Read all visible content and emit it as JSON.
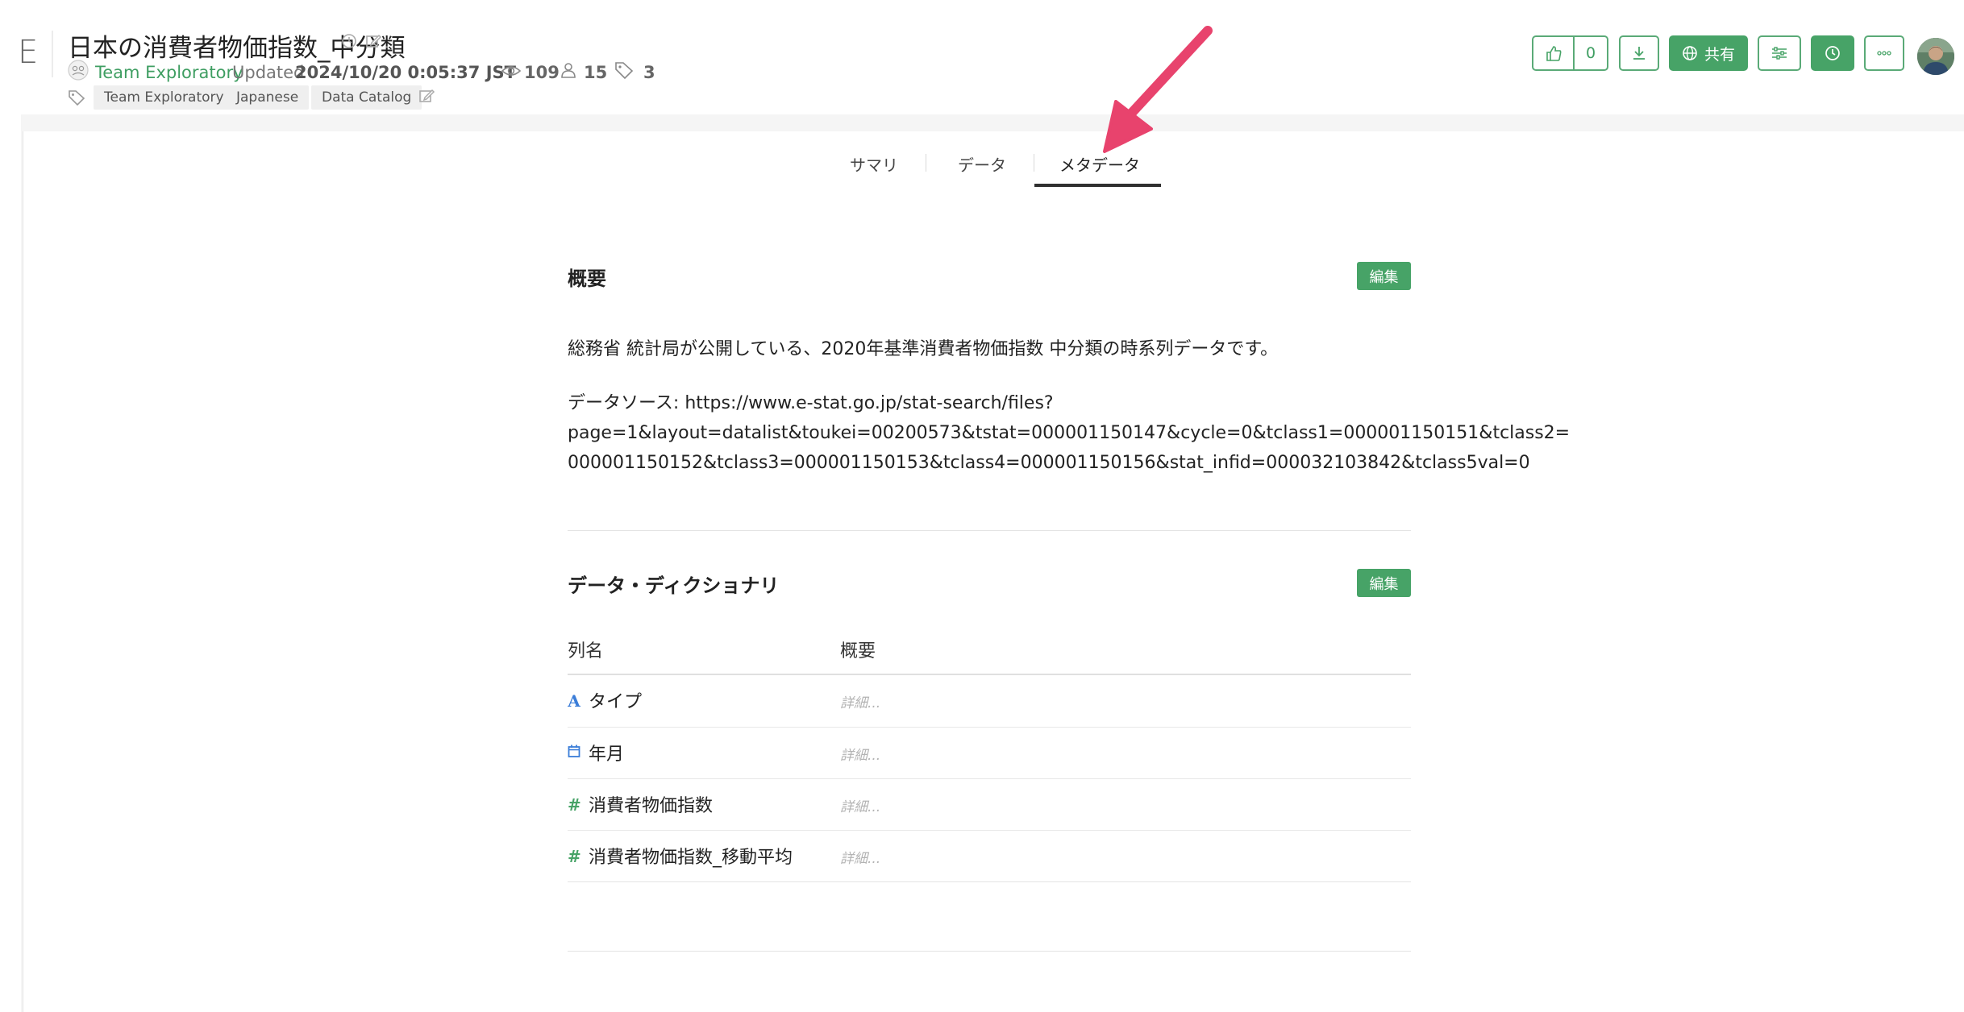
{
  "app": {
    "letter": "E"
  },
  "header": {
    "title": "日本の消費者物価指数_中分類",
    "team": "Team Exploratory",
    "updated_label": "Updated",
    "updated_value": "2024/10/20 0:05:37 JST",
    "views": "109",
    "users": "15",
    "tag_count": "3",
    "tags": [
      "Team Exploratory",
      "Japanese",
      "Data Catalog"
    ]
  },
  "toolbar": {
    "like_count": "0",
    "share_label": "共有"
  },
  "tabs": [
    {
      "label": "サマリ",
      "active": false
    },
    {
      "label": "データ",
      "active": false
    },
    {
      "label": "メタデータ",
      "active": true
    }
  ],
  "overview": {
    "title": "概要",
    "edit_label": "編集",
    "description": "総務省 統計局が公開している、2020年基準消費者物価指数 中分類の時系列データです。",
    "source_label": "データソース:",
    "source_url_1": "https://www.e-stat.go.jp/stat-search/files?",
    "source_url_2": "page=1&layout=datalist&toukei=00200573&tstat=000001150147&cycle=0&tclass1=000001150151&tclass2=",
    "source_url_3": "000001150152&tclass3=000001150153&tclass4=000001150156&stat_infid=000032103842&tclass5val=0"
  },
  "dictionary": {
    "title": "データ・ディクショナリ",
    "edit_label": "編集",
    "col_name_header": "列名",
    "col_desc_header": "概要",
    "rows": [
      {
        "type_icon": "A",
        "name": "タイプ",
        "desc_placeholder": "詳細..."
      },
      {
        "type_icon": "calendar",
        "name": "年月",
        "desc_placeholder": "詳細..."
      },
      {
        "type_icon": "#",
        "name": "消費者物価指数",
        "desc_placeholder": "詳細..."
      },
      {
        "type_icon": "#",
        "name": "消費者物価指数_移動平均",
        "desc_placeholder": "詳細..."
      }
    ]
  },
  "colors": {
    "accent_green": "#47a367",
    "annotation_arrow": "#e8436d",
    "text_type_blue": "#3b7dd8"
  }
}
